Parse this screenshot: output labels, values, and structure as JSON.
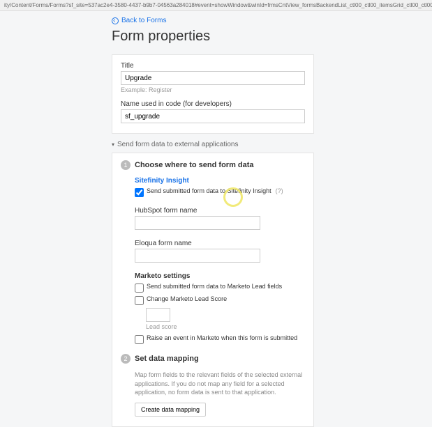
{
  "address_bar": "ity/Content/Forms/Forms?sf_site=537ac2e4-3580-4437-b9b7-04563a284018#event=showWindow&winId=frmsCntView_formsBackendList_ctl00_ctl00_itemsGrid_ctl00_ctl00_edit&autoMax=false",
  "back_link": "Back to Forms",
  "page_title": "Form properties",
  "title_field": {
    "label": "Title",
    "value": "Upgrade",
    "example": "Example: Register"
  },
  "code_name": {
    "label": "Name used in code (for developers)",
    "value": "sf_upgrade"
  },
  "expander": "Send form data to external applications",
  "step1": {
    "num": "1",
    "title": "Choose where to send form data",
    "insight": {
      "heading": "Sitefinity Insight",
      "checkbox": "Send submitted form data to Sitefinity Insight",
      "help": "(?)"
    },
    "hubspot": {
      "label": "HubSpot form name",
      "value": ""
    },
    "eloqua": {
      "label": "Eloqua form name",
      "value": ""
    },
    "marketo": {
      "heading": "Marketo settings",
      "chk1": "Send submitted form data to Marketo Lead fields",
      "chk2": "Change Marketo Lead Score",
      "score_value": "",
      "score_sub": "Lead score",
      "chk3": "Raise an event in Marketo when this form is submitted"
    }
  },
  "step2": {
    "num": "2",
    "title": "Set data mapping",
    "desc": "Map form fields to the relevant fields of the selected external applications. If you do not map any field for a selected application, no form data is sent to that application.",
    "button": "Create data mapping"
  }
}
